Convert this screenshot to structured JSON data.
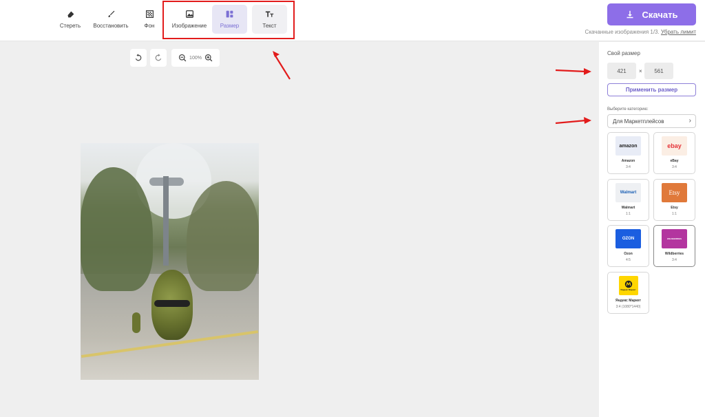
{
  "toolbar": {
    "items": [
      {
        "label": "Стереть",
        "icon": "eraser-icon"
      },
      {
        "label": "Восстановить",
        "icon": "brush-icon"
      },
      {
        "label": "Фон",
        "icon": "background-icon"
      },
      {
        "label": "Изображение",
        "icon": "image-icon"
      },
      {
        "label": "Размер",
        "icon": "layout-icon",
        "active": true
      },
      {
        "label": "Текст",
        "icon": "text-icon"
      }
    ]
  },
  "header": {
    "download_label": "Скачать",
    "limit_text": "Скачанные изображения 1/3.",
    "limit_link": "Убрать лимит"
  },
  "canvas": {
    "zoom": "100%",
    "undo_icon": "undo-icon",
    "redo_icon": "redo-icon",
    "zoom_out_icon": "zoom-out-icon",
    "zoom_in_icon": "zoom-in-icon"
  },
  "sidebar": {
    "custom_size_title": "Свой размер",
    "width": "421",
    "height": "561",
    "separator": "×",
    "apply_label": "Применить размер",
    "category_label": "Выберите категорию:",
    "category_value": "Для Маркетплейсов",
    "presets": [
      {
        "name": "Amazon",
        "ratio": "3:4",
        "logo": "amazon"
      },
      {
        "name": "eBay",
        "ratio": "3:4",
        "logo": "ebay"
      },
      {
        "name": "Walmart",
        "ratio": "1:1",
        "logo": "Walmart"
      },
      {
        "name": "Etsy",
        "ratio": "1:1",
        "logo": "Etsy"
      },
      {
        "name": "Ozon",
        "ratio": "4:5",
        "logo": "OZON"
      },
      {
        "name": "Wildberries",
        "ratio": "3:4",
        "logo": "WILDBERRIES"
      },
      {
        "name": "Яндекс Маркет",
        "ratio": "3:4 (1080*1440)",
        "logo": "Яндекс Маркет"
      }
    ]
  },
  "colors": {
    "accent": "#8d6ee8",
    "active_tab_bg": "#e7e6f5",
    "annotation_red": "#e21b1b"
  }
}
